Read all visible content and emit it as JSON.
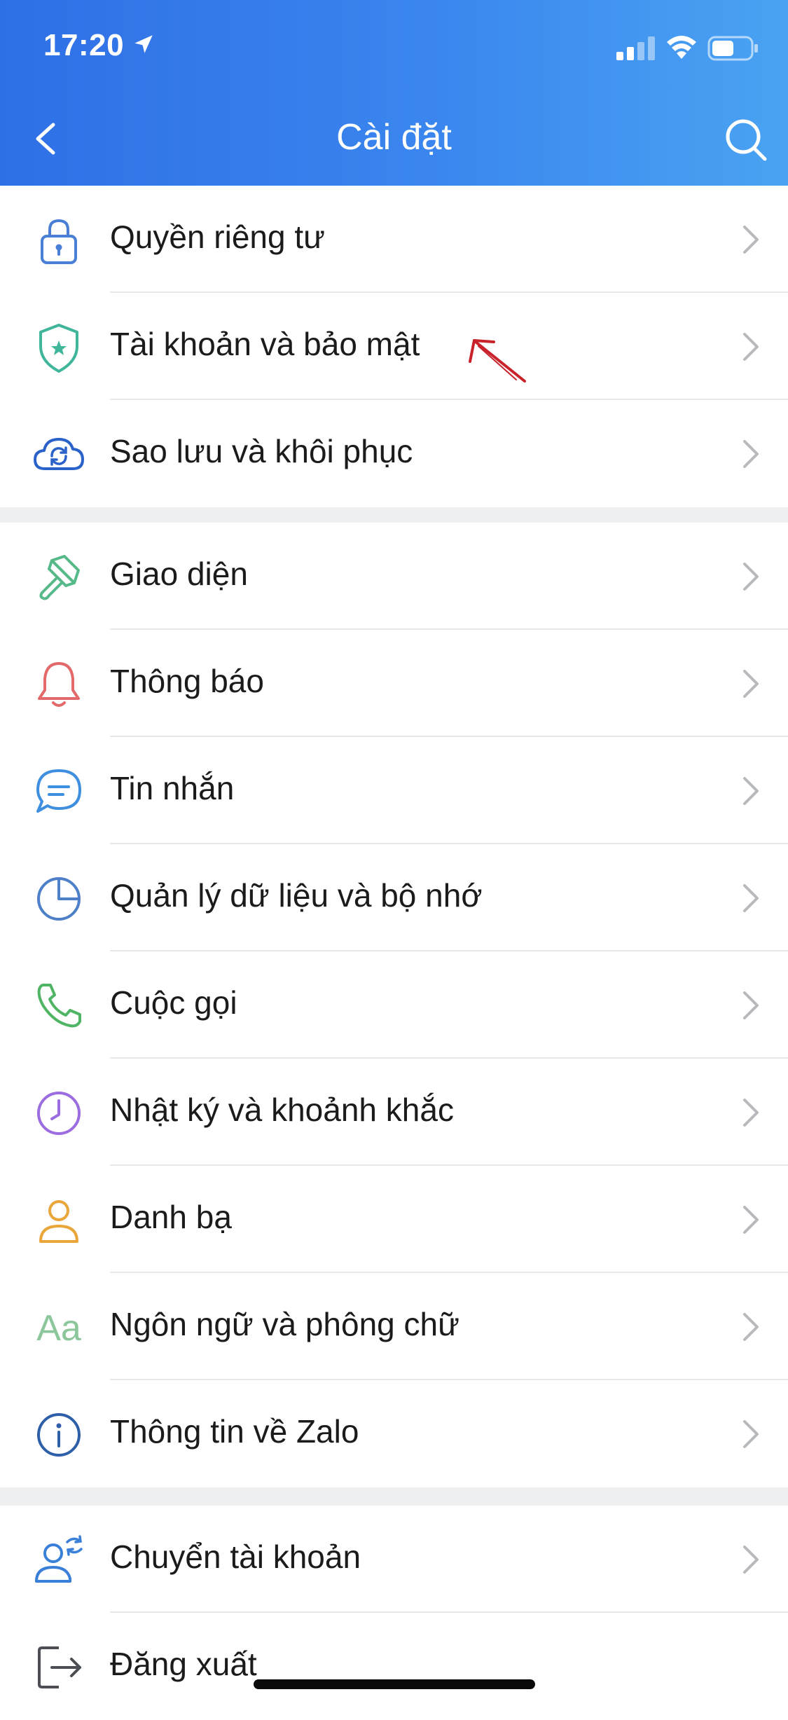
{
  "status_bar": {
    "time": "17:20"
  },
  "header": {
    "title": "Cài đặt"
  },
  "sections": [
    {
      "items": [
        {
          "label": "Quyền riêng tư",
          "icon": "lock-icon",
          "color": "#4a7fd6"
        },
        {
          "label": "Tài khoản và bảo mật",
          "icon": "shield-star-icon",
          "color": "#3fb59a"
        },
        {
          "label": "Sao lưu và khôi phục",
          "icon": "cloud-sync-icon",
          "color": "#2a62c9"
        }
      ]
    },
    {
      "items": [
        {
          "label": "Giao diện",
          "icon": "paint-brush-icon",
          "color": "#56b98a"
        },
        {
          "label": "Thông báo",
          "icon": "bell-icon",
          "color": "#e36a6a"
        },
        {
          "label": "Tin nhắn",
          "icon": "chat-bubble-icon",
          "color": "#3e8fe0"
        },
        {
          "label": "Quản lý dữ liệu và bộ nhớ",
          "icon": "pie-clock-icon",
          "color": "#4e7fc9"
        },
        {
          "label": "Cuộc gọi",
          "icon": "phone-icon",
          "color": "#4fb565"
        },
        {
          "label": "Nhật ký và khoảnh khắc",
          "icon": "clock-icon",
          "color": "#9b6de0"
        },
        {
          "label": "Danh bạ",
          "icon": "person-icon",
          "color": "#e9a63b"
        },
        {
          "label": "Ngôn ngữ và phông chữ",
          "icon": "font-aa-icon",
          "color": "#8bc79a"
        },
        {
          "label": "Thông tin về Zalo",
          "icon": "info-icon",
          "color": "#2f5fa8"
        }
      ]
    },
    {
      "items": [
        {
          "label": "Chuyển tài khoản",
          "icon": "switch-account-icon",
          "color": "#3a7fd8"
        },
        {
          "label": "Đăng xuất",
          "icon": "logout-icon",
          "color": "#4b4f55"
        }
      ]
    }
  ],
  "font_icon_text": "Aa",
  "colors": {
    "header_start": "#2f6fe6",
    "header_end": "#4aa3f2",
    "chevron": "#b7b9bc",
    "annotation": "#c8222a"
  }
}
